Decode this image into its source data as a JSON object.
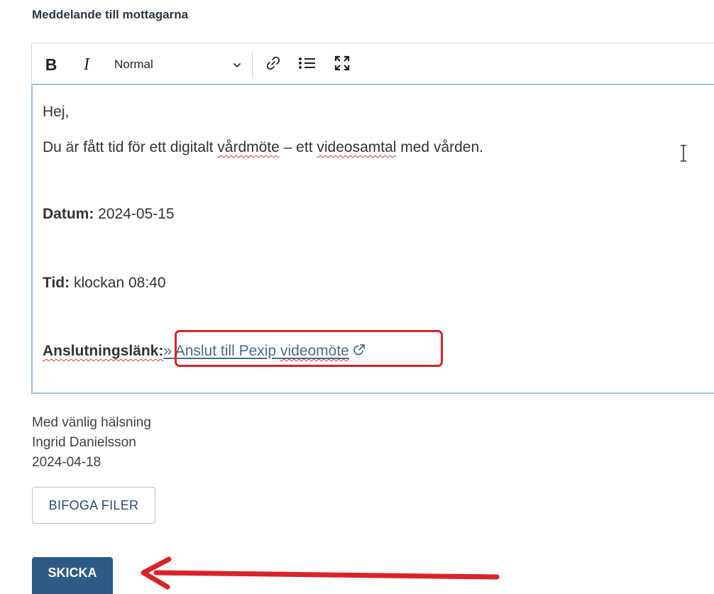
{
  "section_title": "Meddelande till mottagarna",
  "toolbar": {
    "bold_label": "B",
    "italic_label": "I",
    "format_selected": "Normal",
    "icons": [
      "chevron-down-icon",
      "link-icon",
      "bulleted-list-icon",
      "fullscreen-icon"
    ]
  },
  "editor": {
    "greeting": "Hej,",
    "intro_part1": "Du är fått tid för ett digitalt ",
    "intro_word1": "vårdmöte",
    "intro_part2": " – ett ",
    "intro_word2": "videosamtal",
    "intro_part3": " med vården.",
    "date_label": "Datum:",
    "date_value": " 2024-05-15",
    "time_label": "Tid:",
    "time_value": " klockan 08:40",
    "link_label": "Anslutningslänk:",
    "link_text_part1": "» Anslut till Pexip ",
    "link_text_part2": "videomöte"
  },
  "signature": {
    "closing": "Med vänlig hälsning",
    "name": "Ingrid Danielsson",
    "date": "2024-04-18"
  },
  "buttons": {
    "attach_label": "BIFOGA FILER",
    "send_label": "SKICKA"
  },
  "annotation_color": "#d8232a",
  "accent_color": "#2f5a85"
}
